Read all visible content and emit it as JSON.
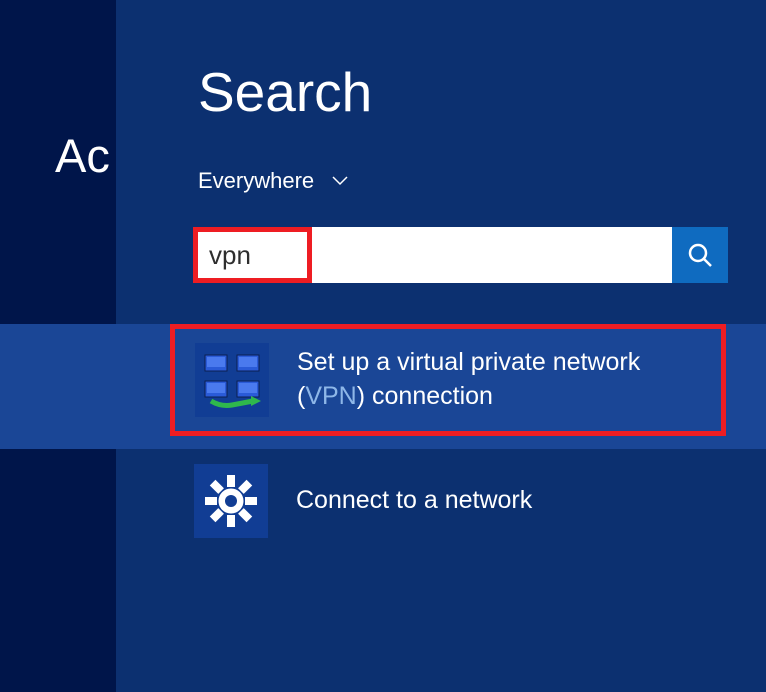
{
  "left": {
    "peek_text": "Ac"
  },
  "search": {
    "title": "Search",
    "scope_label": "Everywhere",
    "input_value": "vpn",
    "button_name": "search-button"
  },
  "results": [
    {
      "text_pre": "Set up a virtual private network (",
      "highlight": "VPN",
      "text_post": ") connection",
      "selected": true,
      "icon": "vpn-network-icon"
    },
    {
      "text": "Connect to a network",
      "selected": false,
      "icon": "gear-icon"
    }
  ]
}
